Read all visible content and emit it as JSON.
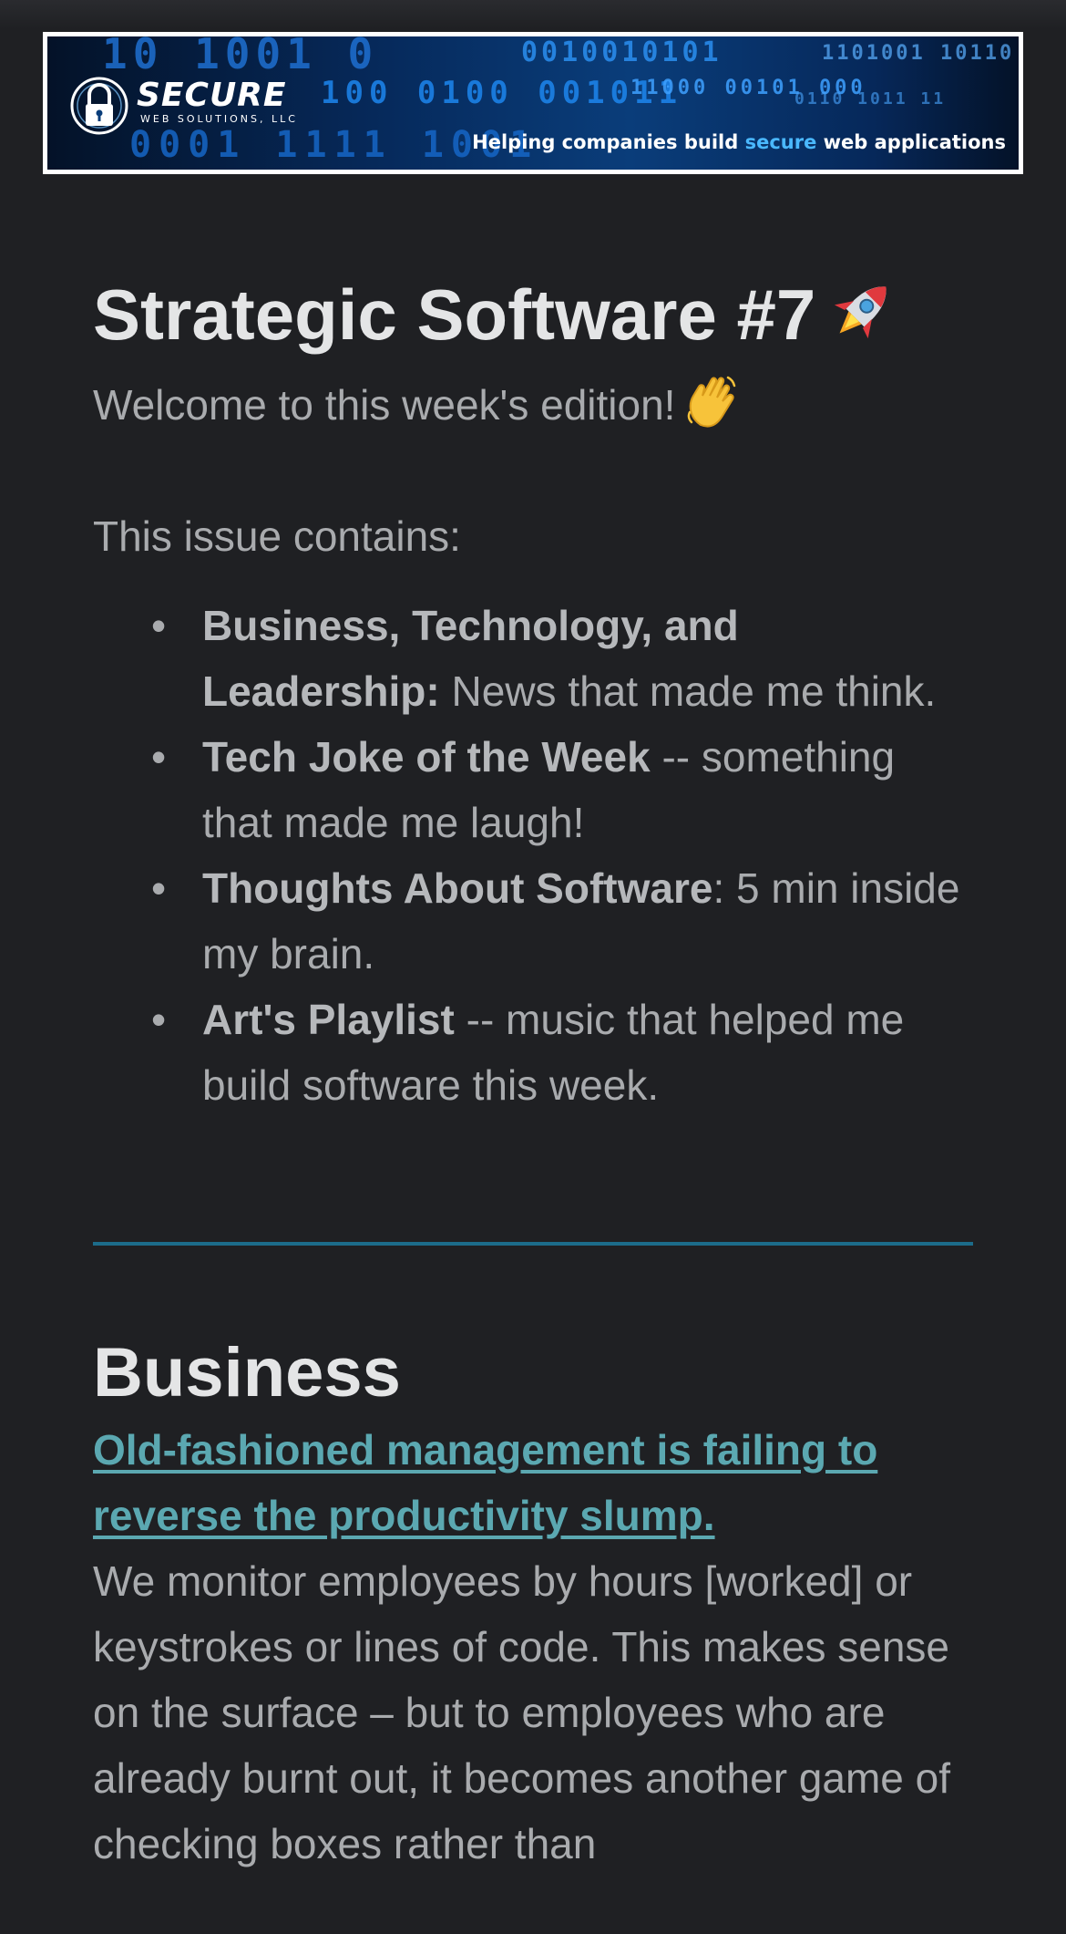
{
  "banner": {
    "brand_name": "SECURE",
    "brand_sub": "WEB SOLUTIONS, LLC",
    "tagline_prefix": "Helping companies build ",
    "tagline_accent": "secure",
    "tagline_suffix": " web applications",
    "binary_rows": [
      "10 1001 0",
      "100 0100 001011",
      "0001 1111 1001",
      "0010010101",
      "11000 00101 000",
      "1101001 10110",
      "0110 1011 11"
    ],
    "accent_color": "#4ab8ff"
  },
  "newsletter": {
    "title": "Strategic Software #7",
    "title_emoji": "rocket-emoji",
    "welcome": "Welcome to this week's edition!",
    "welcome_emoji": "waving-hand-emoji",
    "contains_label": "This issue contains:",
    "items": [
      {
        "bold": "Business, Technology, and Leadership:",
        "text": " News that made me think."
      },
      {
        "bold": "Tech Joke of the Week",
        "text": " -- something that made me laugh!"
      },
      {
        "bold": "Thoughts About Software",
        "text": ": 5 min inside my brain."
      },
      {
        "bold": "Art's Playlist",
        "text": " -- music that helped me build software this week."
      }
    ],
    "bullet": "•"
  },
  "business": {
    "heading": "Business",
    "link_text": "Old-fashioned management is failing to reverse the productivity slump.",
    "body": "We monitor employees by hours [worked] or keystrokes or lines of code. This makes sense on the surface – but to employees who are already burnt out, it becomes another game of checking boxes rather than"
  },
  "colors": {
    "background": "#1f2023",
    "divider": "#1c6c8a",
    "link": "#5ba8b1"
  }
}
